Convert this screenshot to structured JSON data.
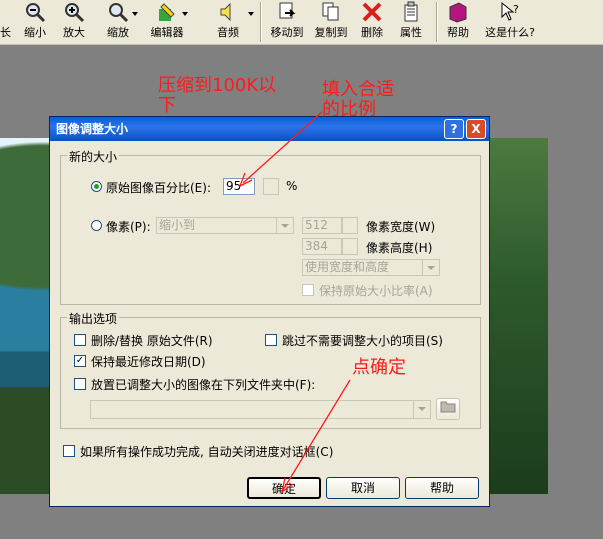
{
  "toolbar": {
    "items": [
      {
        "label": "缩小",
        "icon": "zoom-out-icon"
      },
      {
        "label": "放大",
        "icon": "zoom-in-icon"
      },
      {
        "label": "缩放",
        "icon": "zoom-icon"
      },
      {
        "label": "编辑器",
        "icon": "editor-icon"
      },
      {
        "label": "音频",
        "icon": "audio-icon"
      },
      {
        "label": "移动到",
        "icon": "move-to-icon"
      },
      {
        "label": "复制到",
        "icon": "copy-to-icon"
      },
      {
        "label": "删除",
        "icon": "delete-icon"
      },
      {
        "label": "属性",
        "icon": "properties-icon"
      },
      {
        "label": "帮助",
        "icon": "help-book-icon"
      },
      {
        "label": "这是什么?",
        "icon": "whats-this-icon"
      }
    ],
    "left_partial": "长"
  },
  "annotations": {
    "compress_line1": "压缩到100K以",
    "compress_line2": "下",
    "fill_line1": "填入合适",
    "fill_line2": "的比例",
    "click_ok": "点确定"
  },
  "dialog": {
    "title": "图像调整大小",
    "new_size": {
      "legend": "新的大小",
      "percent_label": "原始图像百分比(E):",
      "percent_value": "95",
      "percent_unit": "%",
      "pixels_label": "像素(P):",
      "pixels_combo": "缩小到",
      "width_value": "512",
      "width_label": "像素宽度(W)",
      "height_value": "384",
      "height_label": "像素高度(H)",
      "mode_combo": "使用宽度和高度",
      "keep_ratio_label": "保持原始大小比率(A)"
    },
    "output": {
      "legend": "输出选项",
      "delete_replace_label": "删除/替换 原始文件(R)",
      "skip_label": "跳过不需要调整大小的项目(S)",
      "keep_date_label": "保持最近修改日期(D)",
      "place_in_folder_label": "放置已调整大小的图像在下列文件夹中(F):",
      "folder_value": ""
    },
    "auto_close_label": "如果所有操作成功完成, 自动关闭进度对话框(C)",
    "buttons": {
      "ok": "确定",
      "cancel": "取消",
      "help": "帮助"
    },
    "help_glyph": "?",
    "close_glyph": "X"
  },
  "colors": {
    "annotation": "#ff1a1a",
    "titlebar": "#0a5fd8"
  }
}
